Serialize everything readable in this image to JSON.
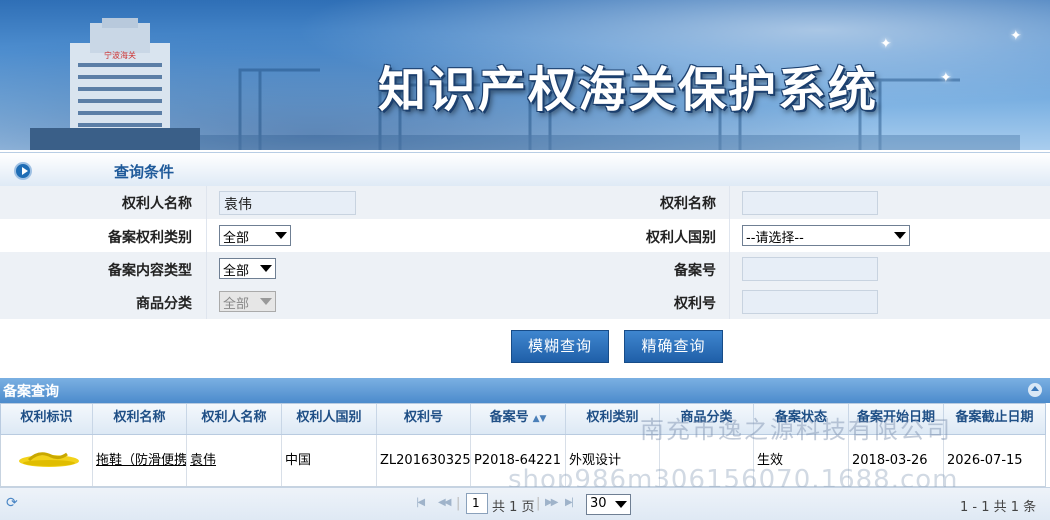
{
  "banner": {
    "title": "知识产权海关保护系统",
    "building_sign": "宁波海关"
  },
  "query": {
    "section_title": "查询条件",
    "fields": {
      "holder_name": {
        "label": "权利人名称",
        "value": "袁伟"
      },
      "right_name": {
        "label": "权利名称",
        "value": ""
      },
      "right_type": {
        "label": "备案权利类别",
        "value": "全部"
      },
      "holder_country": {
        "label": "权利人国别",
        "value": "--请选择--"
      },
      "content_type": {
        "label": "备案内容类型",
        "value": "全部"
      },
      "record_no": {
        "label": "备案号",
        "value": ""
      },
      "goods_class": {
        "label": "商品分类",
        "value": "全部"
      },
      "right_no": {
        "label": "权利号",
        "value": ""
      }
    },
    "buttons": {
      "fuzzy": "模糊查询",
      "exact": "精确查询"
    }
  },
  "results": {
    "section_title": "备案查询",
    "columns": [
      "权利标识",
      "权利名称",
      "权利人名称",
      "权利人国别",
      "权利号",
      "备案号",
      "权利类别",
      "商品分类",
      "备案状态",
      "备案开始日期",
      "备案截止日期"
    ],
    "rows": [
      {
        "mark": "slipper-image",
        "right_name": "拖鞋（防滑便携",
        "holder": "袁伟",
        "country": "中国",
        "right_no": "ZL201630325",
        "record_no": "P2018-64221",
        "right_type": "外观设计",
        "goods_class": "",
        "status": "生效",
        "start_date": "2018-03-26",
        "end_date": "2026-07-15"
      }
    ]
  },
  "pager": {
    "page_input": "1",
    "page_prefix": "",
    "total_pages": "共 1 页",
    "page_size": "30",
    "summary": "1 - 1   共 1 条"
  },
  "watermark": {
    "line1": "南充市逸之源科技有限公司",
    "line2": "shop986m306156070.1688.com"
  },
  "colors": {
    "accent": "#1f5fa8",
    "header_blue": "#4c8bcc"
  }
}
